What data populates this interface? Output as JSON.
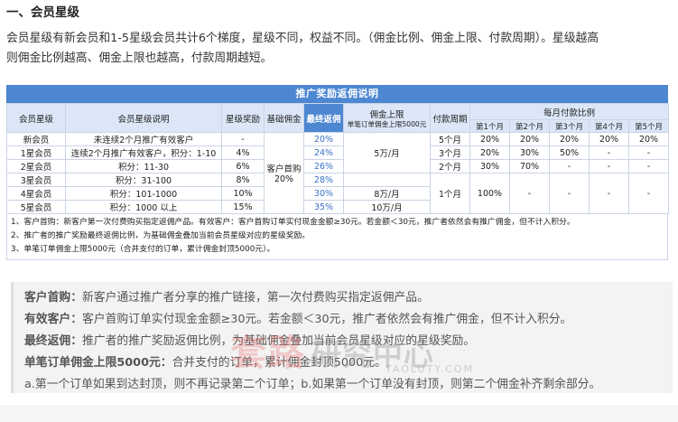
{
  "heading": "一、会员星级",
  "intro_line1": "会员星级有新会员和1-5星级会员共计6个梯度，星级不同，权益不同。（佣金比例、佣金上限、付款周期）。星级越高",
  "intro_line2": "则佣金比例越高、佣金上限也越高，付款周期越短。",
  "table": {
    "banner": "推广奖励返佣说明",
    "headers": {
      "level": "会员星级",
      "desc": "会员星级说明",
      "star_reward": "星级奖励",
      "base_commission": "基础佣金",
      "final_rebate": "最终返佣",
      "cap_line1": "佣金上限",
      "cap_line2": "单笔订单佣金上限5000元",
      "payment_cycle": "付款周期",
      "monthly_ratio": "每月付款比例",
      "months": [
        "第1个月",
        "第2个月",
        "第3个月",
        "第4个月",
        "第5个月"
      ]
    },
    "base_commission_line1": "客户首购",
    "base_commission_line2": "20%",
    "rows": [
      {
        "level": "新会员",
        "desc": "未连续2个月推广有效客户",
        "star": "-",
        "final": "20%"
      },
      {
        "level": "1星会员",
        "desc": "连续2个月推广有效客户，积分：1-10",
        "star": "4%",
        "final": "24%"
      },
      {
        "level": "2星会员",
        "desc": "积分：11-30",
        "star": "6%",
        "final": "26%"
      },
      {
        "level": "3星会员",
        "desc": "积分：31-100",
        "star": "8%",
        "final": "28%"
      },
      {
        "level": "4星会员",
        "desc": "积分：101-1000",
        "star": "10%",
        "final": "30%"
      },
      {
        "level": "5星会员",
        "desc": "积分：1000 以上",
        "star": "15%",
        "final": "35%"
      }
    ],
    "caps": [
      "5万/月",
      "8万/月",
      "10万/月"
    ],
    "cycles": [
      "5个月",
      "3个月",
      "2个月",
      "1个月"
    ],
    "payments": [
      [
        "20%",
        "20%",
        "20%",
        "20%",
        "20%"
      ],
      [
        "20%",
        "30%",
        "50%",
        "-",
        "-"
      ],
      [
        "30%",
        "70%",
        "-",
        "-",
        "-"
      ],
      [
        "100%",
        "-",
        "-",
        "-",
        "-"
      ]
    ],
    "notes": [
      "1、客户首购：新客户第一次付费购买指定返佣产品。有效客户：客户首购订单实付现金金额≥30元。若金额＜30元，推广者依然会有推广佣金，但不计入积分。",
      "2、推广者的推广奖励最终返佣比例，为基础佣金叠加当前会员星级对应的星级奖励。",
      "3、单笔订单佣金上限5000元（合并支付的订单，累计佣金封顶5000元）。"
    ]
  },
  "definitions": [
    {
      "term": "客户首购：",
      "text": "新客户通过推广者分享的推广链接，第一次付费购买指定返佣产品。"
    },
    {
      "term": "有效客户：",
      "text": "客户首购订单实付现金金额≥30元。若金额＜30元，推广者依然会有推广佣金，但不计入积分。"
    },
    {
      "term": "最终返佣：",
      "text": "推广者的推广奖励返佣比例，为基础佣金叠加当前会员星级对应的星级奖励。"
    },
    {
      "term": "单笔订单佣金上限5000元：",
      "text": "合并支付的订单，累计佣金封顶5000元。"
    },
    {
      "term": "",
      "text": "a.第一个订单如果到达封顶，则不再记录第二个订单；b.如果第一个订单没有封顶，则第二个佣金补齐剩余部分。"
    }
  ],
  "watermark": {
    "main": "套路",
    "sub": "研究中心",
    "url": "TAOLUTY.COM"
  },
  "colors": {
    "banner": "#4d86d1",
    "header_bg": "#dbe6f6",
    "rebate_text": "#3b73c4",
    "quote_bg": "#f3f3f3"
  }
}
